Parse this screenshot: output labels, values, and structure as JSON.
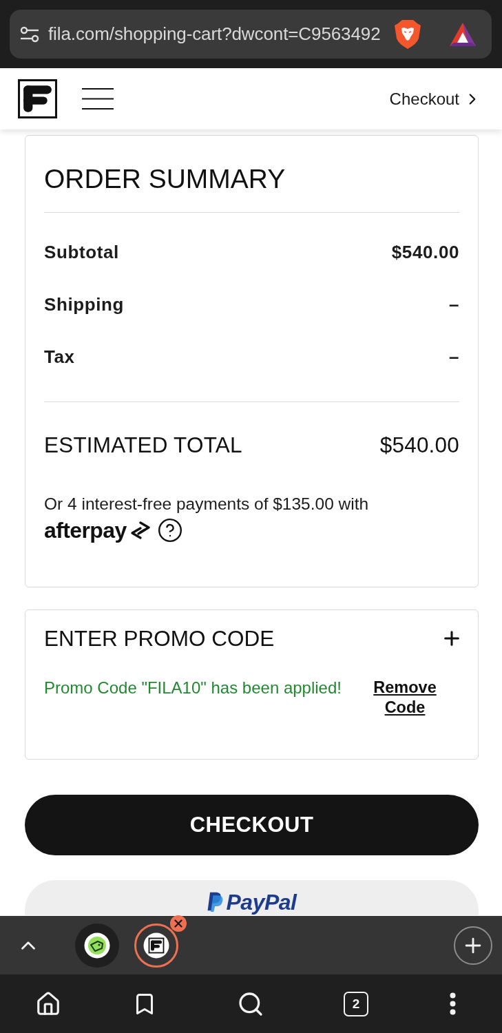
{
  "browser": {
    "url": "fila.com/shopping-cart?dwcont=C9563492"
  },
  "header": {
    "checkout_link": "Checkout"
  },
  "order_summary": {
    "title": "ORDER SUMMARY",
    "rows": [
      {
        "label": "Subtotal",
        "value": "$540.00"
      },
      {
        "label": "Shipping",
        "value": "–"
      },
      {
        "label": "Tax",
        "value": "–"
      }
    ],
    "total": {
      "label": "ESTIMATED TOTAL",
      "value": "$540.00"
    },
    "installments": {
      "text": "Or 4 interest-free payments of $135.00 with",
      "brand": "afterpay"
    }
  },
  "promo": {
    "title": "ENTER PROMO CODE",
    "message": "Promo Code \"FILA10\" has been applied!",
    "remove_link": "Remove Code"
  },
  "checkout_button": "CHECKOUT",
  "paypal_button": "PayPal",
  "tab_strip": {
    "tabs": [
      {
        "kind": "tag",
        "selected": false
      },
      {
        "kind": "fila",
        "selected": true
      }
    ]
  },
  "bottom_nav": {
    "tab_count": "2"
  }
}
